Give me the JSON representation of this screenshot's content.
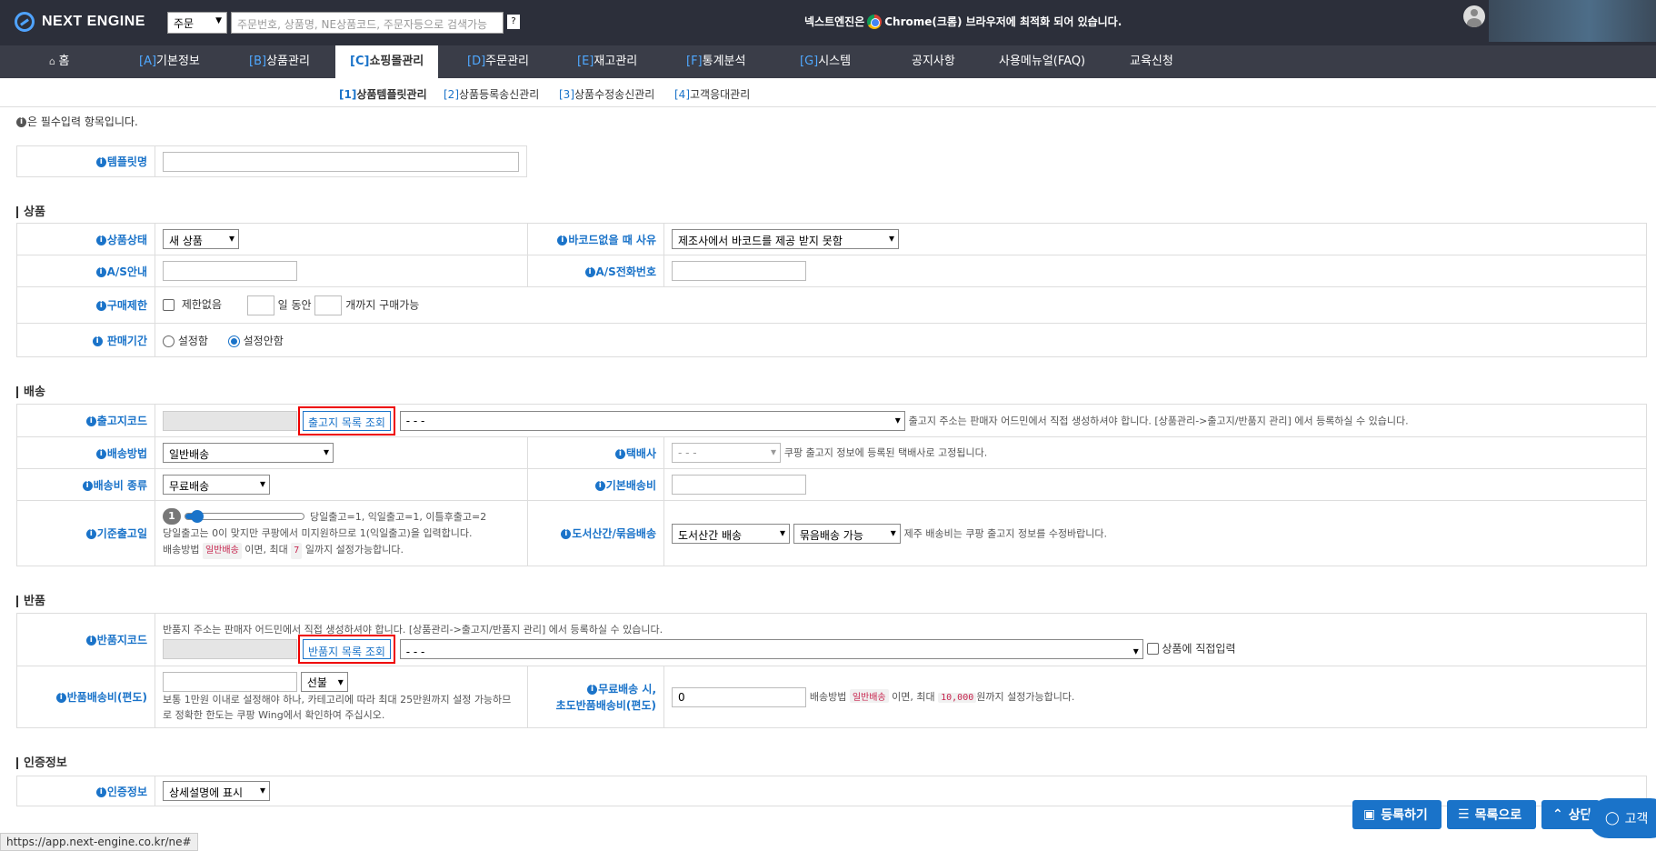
{
  "header": {
    "logo_text": "NEXT ENGINE",
    "search_type": "주문",
    "search_placeholder": "주문번호, 상품명, NE상품코드, 주문자등으로 검색가능",
    "search_help": "?",
    "notice_before": "넥스트엔진은",
    "notice_after": "Chrome(크롬) 브라우저에 최적화 되어 있습니다."
  },
  "nav": {
    "items": [
      {
        "key": "",
        "label": "홈"
      },
      {
        "key": "[A]",
        "label": "기본정보"
      },
      {
        "key": "[B]",
        "label": "상품관리"
      },
      {
        "key": "[C]",
        "label": "쇼핑몰관리"
      },
      {
        "key": "[D]",
        "label": "주문관리"
      },
      {
        "key": "[E]",
        "label": "재고관리"
      },
      {
        "key": "[F]",
        "label": "통계분석"
      },
      {
        "key": "[G]",
        "label": "시스템"
      },
      {
        "key": "",
        "label": "공지사항"
      },
      {
        "key": "",
        "label": "사용메뉴얼(FAQ)"
      },
      {
        "key": "",
        "label": "교육신청"
      }
    ]
  },
  "subnav": {
    "items": [
      {
        "key": "[1]",
        "label": "상품템플릿관리"
      },
      {
        "key": "[2]",
        "label": "상품등록송신관리"
      },
      {
        "key": "[3]",
        "label": "상품수정송신관리"
      },
      {
        "key": "[4]",
        "label": "고객응대관리"
      }
    ]
  },
  "form": {
    "required_note": "은 필수입력 항목입니다.",
    "template_name_label": "템플릿명",
    "product": {
      "title": "상품",
      "status_label": "상품상태",
      "status_value": "새 상품",
      "no_barcode_label": "바코드없을 때 사유",
      "no_barcode_value": "제조사에서 바코드를 제공 받지 못함",
      "as_info_label": "A/S안내",
      "as_phone_label": "A/S전화번호",
      "purchase_limit_label": "구매제한",
      "no_limit_text": "제한없음",
      "days_text": "일 동안",
      "qty_text": "개까지 구매가능",
      "sale_period_label": "판매기간",
      "sale_set": "설정함",
      "sale_unset": "설정안함"
    },
    "shipping": {
      "title": "배송",
      "origin_code_label": "출고지코드",
      "origin_lookup_btn": "출고지 목록 조회",
      "origin_select": "- - -",
      "origin_hint": "출고지 주소는 판매자 어드민에서 직접 생성하셔야 합니다. [상품관리->출고지/반품지 관리] 에서 등록하실 수 있습니다.",
      "method_label": "배송방법",
      "method_value": "일반배송",
      "courier_label": "택배사",
      "courier_value": "- - -",
      "courier_hint": "쿠팡 출고지 정보에 등록된 택배사로 고정됩니다.",
      "fee_type_label": "배송비 종류",
      "fee_type_value": "무료배송",
      "base_fee_label": "기본배송비",
      "lead_time_label": "기준출고일",
      "lead_time_value": "1",
      "lead_time_fraction": 0.05,
      "lead_time_legend": "당일출고=1, 익일출고=1, 이틀후출고=2",
      "lead_time_hint1": "당일출고는 0이 맞지만 쿠팡에서 미지원하므로 1(익일출고)을 입력합니다.",
      "lead_time_hint2_a": "배송방법",
      "lead_time_tag1": "일반배송",
      "lead_time_hint2_b": "이면, 최대",
      "lead_time_tag2": "7",
      "lead_time_hint2_c": "일까지 설정가능합니다.",
      "island_label": "도서산간/묶음배송",
      "island_value": "도서산간 배송",
      "bundle_value": "묶음배송 가능",
      "island_hint": "제주 배송비는 쿠팡 출고지 정보를 수정바랍니다."
    },
    "returns": {
      "title": "반품",
      "hint": "반품지 주소는 판매자 어드민에서 직접 생성하셔야 합니다. [상품관리->출고지/반품지 관리] 에서 등록하실 수 있습니다.",
      "return_code_label": "반품지코드",
      "return_lookup_btn": "반품지 목록 조회",
      "return_select": "- - -",
      "direct_input": "상품에 직접입력",
      "return_fee_label": "반품배송비(편도)",
      "prepaid_value": "선불",
      "return_fee_hint1": "보통 1만원 이내로 설정해야 하나, 카테고리에 따라 최대 25만원까지 설정 가능하므",
      "return_fee_hint2": "로 정확한 한도는 쿠팡 Wing에서 확인하여 주십시오.",
      "free_return_label1": "무료배송 시,",
      "free_return_label2": "초도반품배송비(편도)",
      "free_return_value": "0",
      "free_hint_a": "배송방법",
      "free_tag1": "일반배송",
      "free_hint_b": "이면, 최대",
      "free_tag2": "10,000",
      "free_hint_c": "원까지 설정가능합니다."
    },
    "cert": {
      "title": "인증정보",
      "label": "인증정보",
      "value": "상세설명에 표시"
    }
  },
  "actions": {
    "register": "등록하기",
    "list": "목록으로",
    "top": "상단",
    "chat": "고객"
  },
  "status_url": "https://app.next-engine.co.kr/ne#"
}
